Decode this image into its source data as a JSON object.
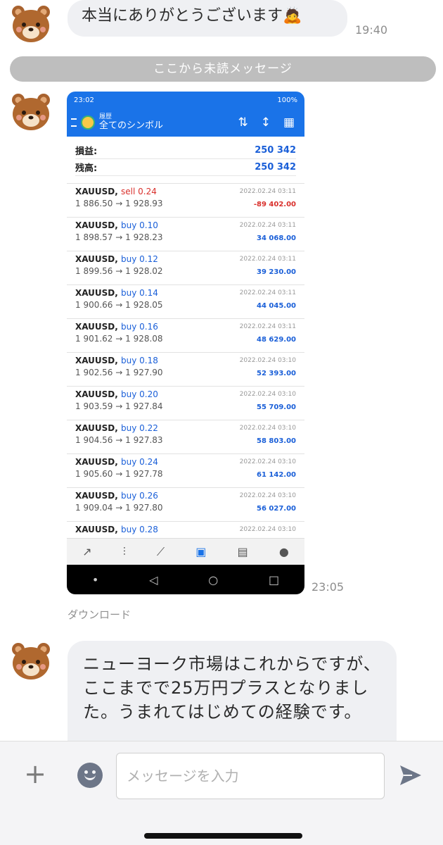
{
  "messages": {
    "first": {
      "text": "本当にありがとうございます🙇",
      "time": "19:40"
    },
    "unread_label": "ここから未読メッセージ",
    "image_message": {
      "time": "23:05",
      "download_label": "ダウンロード"
    },
    "last": {
      "text": "ニューヨーク市場はこれからですが、ここまでで25万円プラスとなりました。うまれてはじめての経験です。"
    }
  },
  "screenshot": {
    "status": {
      "time": "23:02",
      "battery": "100%"
    },
    "appbar": {
      "subtitle": "履歴",
      "title": "全てのシンボル"
    },
    "summary": [
      {
        "label": "損益:",
        "value": "250 342"
      },
      {
        "label": "残高:",
        "value": "250 342"
      }
    ],
    "trades": [
      {
        "symbol": "XAUUSD,",
        "dir": "sell 0.24",
        "prices": "1 886.50 → 1 928.93",
        "date": "2022.02.24 03:11",
        "profit": "-89 402.00",
        "neg": true
      },
      {
        "symbol": "XAUUSD,",
        "dir": "buy 0.10",
        "prices": "1 898.57 → 1 928.23",
        "date": "2022.02.24 03:11",
        "profit": "34 068.00"
      },
      {
        "symbol": "XAUUSD,",
        "dir": "buy 0.12",
        "prices": "1 899.56 → 1 928.02",
        "date": "2022.02.24 03:11",
        "profit": "39 230.00"
      },
      {
        "symbol": "XAUUSD,",
        "dir": "buy 0.14",
        "prices": "1 900.66 → 1 928.05",
        "date": "2022.02.24 03:11",
        "profit": "44 045.00"
      },
      {
        "symbol": "XAUUSD,",
        "dir": "buy 0.16",
        "prices": "1 901.62 → 1 928.08",
        "date": "2022.02.24 03:11",
        "profit": "48 629.00"
      },
      {
        "symbol": "XAUUSD,",
        "dir": "buy 0.18",
        "prices": "1 902.56 → 1 927.90",
        "date": "2022.02.24 03:10",
        "profit": "52 393.00"
      },
      {
        "symbol": "XAUUSD,",
        "dir": "buy 0.20",
        "prices": "1 903.59 → 1 927.84",
        "date": "2022.02.24 03:10",
        "profit": "55 709.00"
      },
      {
        "symbol": "XAUUSD,",
        "dir": "buy 0.22",
        "prices": "1 904.56 → 1 927.83",
        "date": "2022.02.24 03:10",
        "profit": "58 803.00"
      },
      {
        "symbol": "XAUUSD,",
        "dir": "buy 0.24",
        "prices": "1 905.60 → 1 927.78",
        "date": "2022.02.24 03:10",
        "profit": "61 142.00"
      },
      {
        "symbol": "XAUUSD,",
        "dir": "buy 0.26",
        "prices": "1 909.04 → 1 927.80",
        "date": "2022.02.24 03:10",
        "profit": "56 027.00"
      },
      {
        "symbol": "XAUUSD,",
        "dir": "buy 0.28",
        "prices": "",
        "date": "2022.02.24 03:10",
        "profit": ""
      }
    ]
  },
  "input": {
    "placeholder": "メッセージを入力"
  },
  "colors": {
    "bubble": "#eff0f3",
    "unread_bar": "#bebebe",
    "accent": "#1a73e8"
  }
}
